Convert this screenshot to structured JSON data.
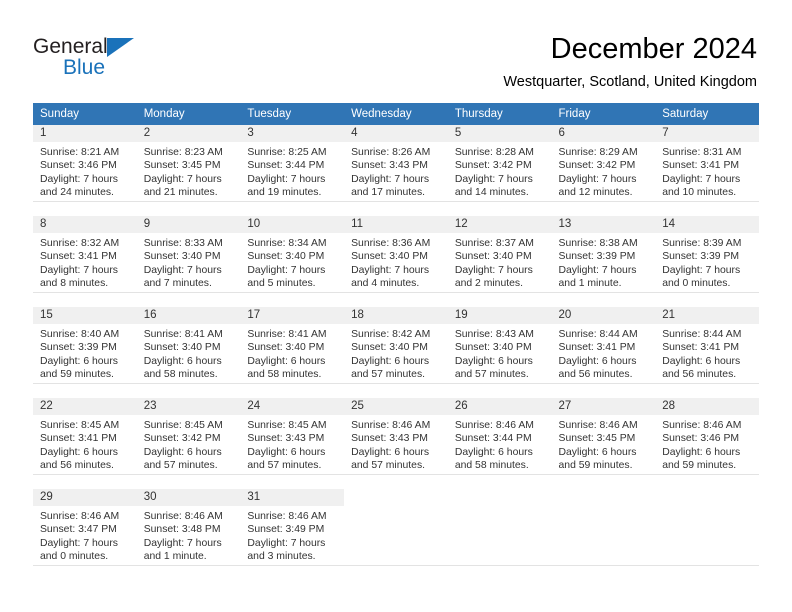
{
  "logo": {
    "word_one": "General",
    "word_two": "Blue",
    "triangle_color": "#1a72ba",
    "text_color": "#231f20"
  },
  "header": {
    "title": "December 2024",
    "subtitle": "Westquarter, Scotland, United Kingdom"
  },
  "theme": {
    "header_row_bg": "#3075b5",
    "header_row_text": "#ffffff",
    "daynum_band_bg": "#f0f0f0",
    "cell_text": "#333333",
    "row_divider": "#e3e3e3"
  },
  "weekdays": [
    "Sunday",
    "Monday",
    "Tuesday",
    "Wednesday",
    "Thursday",
    "Friday",
    "Saturday"
  ],
  "weeks": [
    [
      {
        "day": "1",
        "sunrise": "Sunrise: 8:21 AM",
        "sunset": "Sunset: 3:46 PM",
        "daylight1": "Daylight: 7 hours",
        "daylight2": "and 24 minutes."
      },
      {
        "day": "2",
        "sunrise": "Sunrise: 8:23 AM",
        "sunset": "Sunset: 3:45 PM",
        "daylight1": "Daylight: 7 hours",
        "daylight2": "and 21 minutes."
      },
      {
        "day": "3",
        "sunrise": "Sunrise: 8:25 AM",
        "sunset": "Sunset: 3:44 PM",
        "daylight1": "Daylight: 7 hours",
        "daylight2": "and 19 minutes."
      },
      {
        "day": "4",
        "sunrise": "Sunrise: 8:26 AM",
        "sunset": "Sunset: 3:43 PM",
        "daylight1": "Daylight: 7 hours",
        "daylight2": "and 17 minutes."
      },
      {
        "day": "5",
        "sunrise": "Sunrise: 8:28 AM",
        "sunset": "Sunset: 3:42 PM",
        "daylight1": "Daylight: 7 hours",
        "daylight2": "and 14 minutes."
      },
      {
        "day": "6",
        "sunrise": "Sunrise: 8:29 AM",
        "sunset": "Sunset: 3:42 PM",
        "daylight1": "Daylight: 7 hours",
        "daylight2": "and 12 minutes."
      },
      {
        "day": "7",
        "sunrise": "Sunrise: 8:31 AM",
        "sunset": "Sunset: 3:41 PM",
        "daylight1": "Daylight: 7 hours",
        "daylight2": "and 10 minutes."
      }
    ],
    [
      {
        "day": "8",
        "sunrise": "Sunrise: 8:32 AM",
        "sunset": "Sunset: 3:41 PM",
        "daylight1": "Daylight: 7 hours",
        "daylight2": "and 8 minutes."
      },
      {
        "day": "9",
        "sunrise": "Sunrise: 8:33 AM",
        "sunset": "Sunset: 3:40 PM",
        "daylight1": "Daylight: 7 hours",
        "daylight2": "and 7 minutes."
      },
      {
        "day": "10",
        "sunrise": "Sunrise: 8:34 AM",
        "sunset": "Sunset: 3:40 PM",
        "daylight1": "Daylight: 7 hours",
        "daylight2": "and 5 minutes."
      },
      {
        "day": "11",
        "sunrise": "Sunrise: 8:36 AM",
        "sunset": "Sunset: 3:40 PM",
        "daylight1": "Daylight: 7 hours",
        "daylight2": "and 4 minutes."
      },
      {
        "day": "12",
        "sunrise": "Sunrise: 8:37 AM",
        "sunset": "Sunset: 3:40 PM",
        "daylight1": "Daylight: 7 hours",
        "daylight2": "and 2 minutes."
      },
      {
        "day": "13",
        "sunrise": "Sunrise: 8:38 AM",
        "sunset": "Sunset: 3:39 PM",
        "daylight1": "Daylight: 7 hours",
        "daylight2": "and 1 minute."
      },
      {
        "day": "14",
        "sunrise": "Sunrise: 8:39 AM",
        "sunset": "Sunset: 3:39 PM",
        "daylight1": "Daylight: 7 hours",
        "daylight2": "and 0 minutes."
      }
    ],
    [
      {
        "day": "15",
        "sunrise": "Sunrise: 8:40 AM",
        "sunset": "Sunset: 3:39 PM",
        "daylight1": "Daylight: 6 hours",
        "daylight2": "and 59 minutes."
      },
      {
        "day": "16",
        "sunrise": "Sunrise: 8:41 AM",
        "sunset": "Sunset: 3:40 PM",
        "daylight1": "Daylight: 6 hours",
        "daylight2": "and 58 minutes."
      },
      {
        "day": "17",
        "sunrise": "Sunrise: 8:41 AM",
        "sunset": "Sunset: 3:40 PM",
        "daylight1": "Daylight: 6 hours",
        "daylight2": "and 58 minutes."
      },
      {
        "day": "18",
        "sunrise": "Sunrise: 8:42 AM",
        "sunset": "Sunset: 3:40 PM",
        "daylight1": "Daylight: 6 hours",
        "daylight2": "and 57 minutes."
      },
      {
        "day": "19",
        "sunrise": "Sunrise: 8:43 AM",
        "sunset": "Sunset: 3:40 PM",
        "daylight1": "Daylight: 6 hours",
        "daylight2": "and 57 minutes."
      },
      {
        "day": "20",
        "sunrise": "Sunrise: 8:44 AM",
        "sunset": "Sunset: 3:41 PM",
        "daylight1": "Daylight: 6 hours",
        "daylight2": "and 56 minutes."
      },
      {
        "day": "21",
        "sunrise": "Sunrise: 8:44 AM",
        "sunset": "Sunset: 3:41 PM",
        "daylight1": "Daylight: 6 hours",
        "daylight2": "and 56 minutes."
      }
    ],
    [
      {
        "day": "22",
        "sunrise": "Sunrise: 8:45 AM",
        "sunset": "Sunset: 3:41 PM",
        "daylight1": "Daylight: 6 hours",
        "daylight2": "and 56 minutes."
      },
      {
        "day": "23",
        "sunrise": "Sunrise: 8:45 AM",
        "sunset": "Sunset: 3:42 PM",
        "daylight1": "Daylight: 6 hours",
        "daylight2": "and 57 minutes."
      },
      {
        "day": "24",
        "sunrise": "Sunrise: 8:45 AM",
        "sunset": "Sunset: 3:43 PM",
        "daylight1": "Daylight: 6 hours",
        "daylight2": "and 57 minutes."
      },
      {
        "day": "25",
        "sunrise": "Sunrise: 8:46 AM",
        "sunset": "Sunset: 3:43 PM",
        "daylight1": "Daylight: 6 hours",
        "daylight2": "and 57 minutes."
      },
      {
        "day": "26",
        "sunrise": "Sunrise: 8:46 AM",
        "sunset": "Sunset: 3:44 PM",
        "daylight1": "Daylight: 6 hours",
        "daylight2": "and 58 minutes."
      },
      {
        "day": "27",
        "sunrise": "Sunrise: 8:46 AM",
        "sunset": "Sunset: 3:45 PM",
        "daylight1": "Daylight: 6 hours",
        "daylight2": "and 59 minutes."
      },
      {
        "day": "28",
        "sunrise": "Sunrise: 8:46 AM",
        "sunset": "Sunset: 3:46 PM",
        "daylight1": "Daylight: 6 hours",
        "daylight2": "and 59 minutes."
      }
    ],
    [
      {
        "day": "29",
        "sunrise": "Sunrise: 8:46 AM",
        "sunset": "Sunset: 3:47 PM",
        "daylight1": "Daylight: 7 hours",
        "daylight2": "and 0 minutes."
      },
      {
        "day": "30",
        "sunrise": "Sunrise: 8:46 AM",
        "sunset": "Sunset: 3:48 PM",
        "daylight1": "Daylight: 7 hours",
        "daylight2": "and 1 minute."
      },
      {
        "day": "31",
        "sunrise": "Sunrise: 8:46 AM",
        "sunset": "Sunset: 3:49 PM",
        "daylight1": "Daylight: 7 hours",
        "daylight2": "and 3 minutes."
      },
      {
        "day": "",
        "sunrise": "",
        "sunset": "",
        "daylight1": "",
        "daylight2": ""
      },
      {
        "day": "",
        "sunrise": "",
        "sunset": "",
        "daylight1": "",
        "daylight2": ""
      },
      {
        "day": "",
        "sunrise": "",
        "sunset": "",
        "daylight1": "",
        "daylight2": ""
      },
      {
        "day": "",
        "sunrise": "",
        "sunset": "",
        "daylight1": "",
        "daylight2": ""
      }
    ]
  ]
}
